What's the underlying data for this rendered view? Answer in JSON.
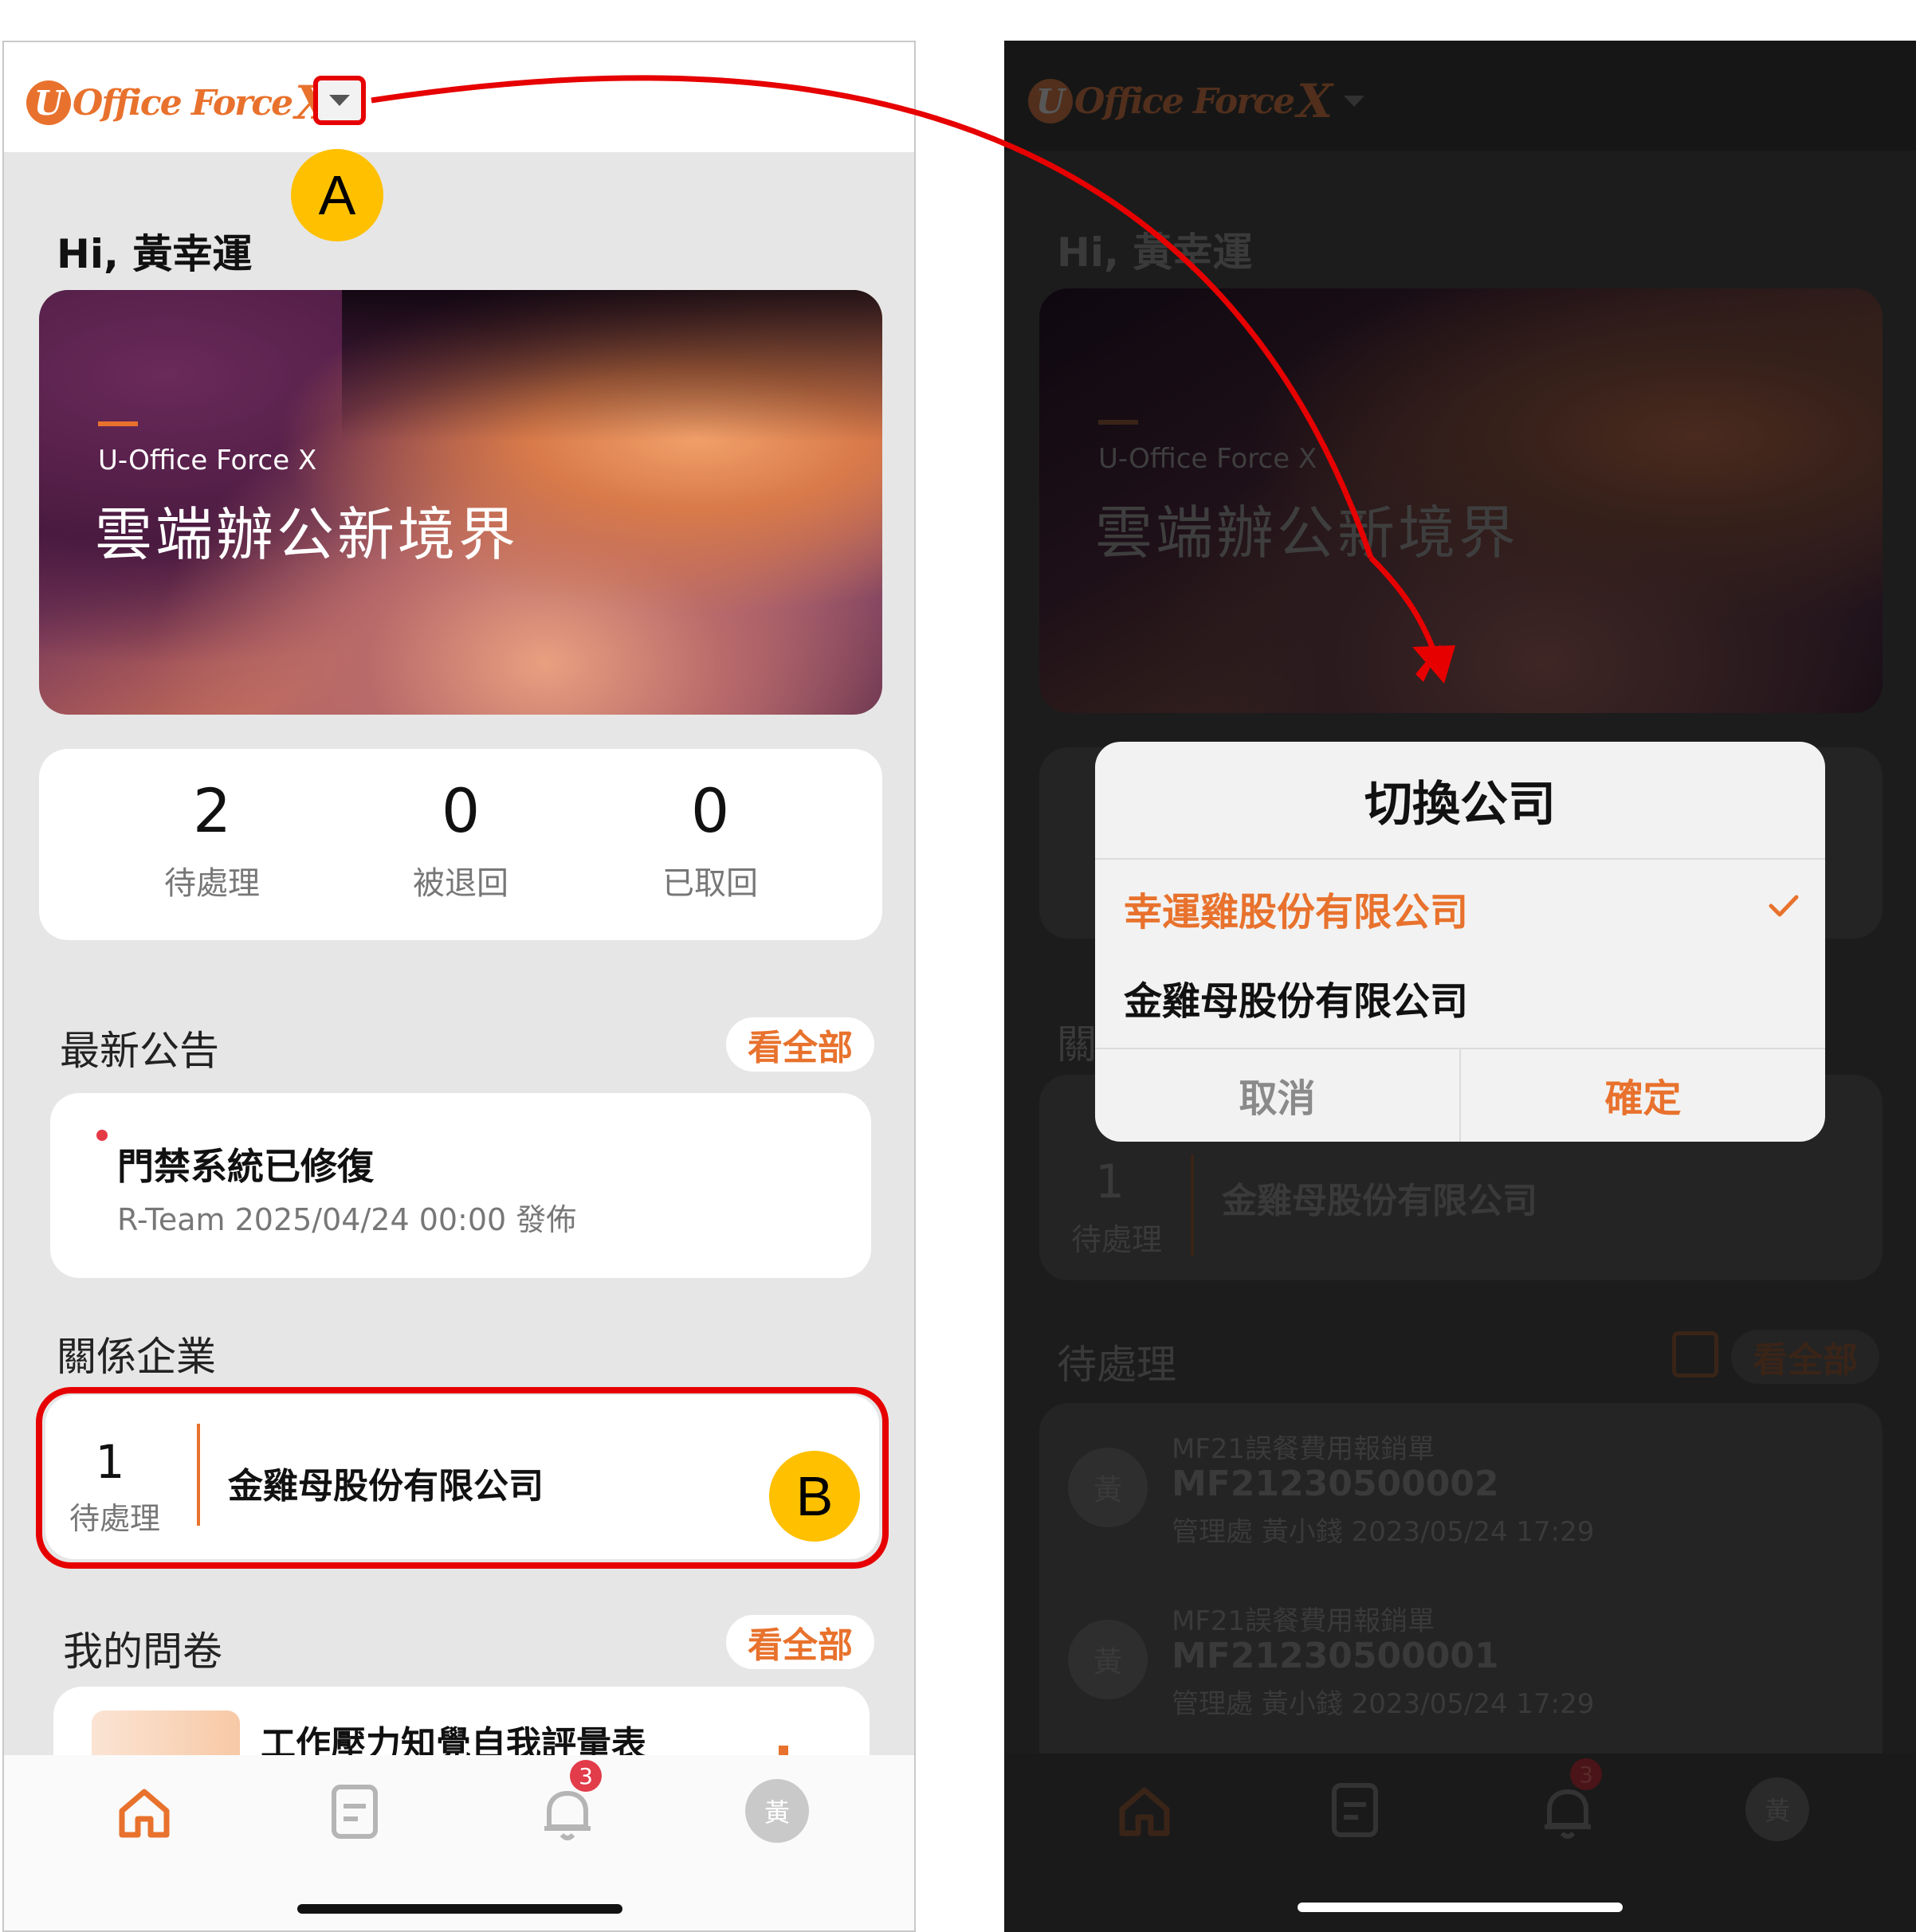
{
  "left": {
    "logo": {
      "u": "U",
      "text": "Office Force",
      "x": "X"
    },
    "callout_a": "A",
    "callout_b": "B",
    "greeting": "Hi, 黃幸運",
    "banner": {
      "subtitle": "U-Office Force X",
      "title": "雲端辦公新境界"
    },
    "stats": [
      {
        "value": "2",
        "label": "待處理"
      },
      {
        "value": "0",
        "label": "被退回"
      },
      {
        "value": "0",
        "label": "已取回"
      }
    ],
    "announcements": {
      "title": "最新公告",
      "view_all": "看全部",
      "item": {
        "title": "門禁系統已修復",
        "meta": "R-Team 2025/04/24 00:00 發佈"
      }
    },
    "related": {
      "title": "關係企業",
      "count": "1",
      "count_label": "待處理",
      "company": "金雞母股份有限公司"
    },
    "survey": {
      "title": "我的問卷",
      "view_all": "看全部",
      "item": "工作壓力知覺自我評量表"
    },
    "nav": {
      "notification_count": "3",
      "avatar": "黃"
    }
  },
  "right": {
    "greeting": "Hi, 黃幸運",
    "banner": {
      "subtitle": "U-Office Force X",
      "title": "雲端辦公新境界"
    },
    "bg_related": {
      "title_fragment": "關",
      "count": "1",
      "count_label": "待處理",
      "company": "金雞母股份有限公司"
    },
    "pending": {
      "title": "待處理",
      "view_all": "看全部",
      "items": [
        {
          "avatar": "黃",
          "type": "MF21誤餐費用報銷單",
          "id": "MF21230500002",
          "meta": "管理處 黃小錢 2023/05/24 17:29"
        },
        {
          "avatar": "黃",
          "type": "MF21誤餐費用報銷單",
          "id": "MF21230500001",
          "meta": "管理處 黃小錢 2023/05/24 17:29"
        }
      ]
    },
    "dialog": {
      "title": "切換公司",
      "options": [
        {
          "label": "幸運雞股份有限公司",
          "selected": true
        },
        {
          "label": "金雞母股份有限公司",
          "selected": false
        }
      ],
      "cancel": "取消",
      "confirm": "確定"
    },
    "nav": {
      "notification_count": "3",
      "avatar": "黃"
    }
  },
  "colors": {
    "accent": "#e8722d",
    "highlight": "#e60000",
    "callout": "#ffc000",
    "badge": "#e23b4a"
  }
}
